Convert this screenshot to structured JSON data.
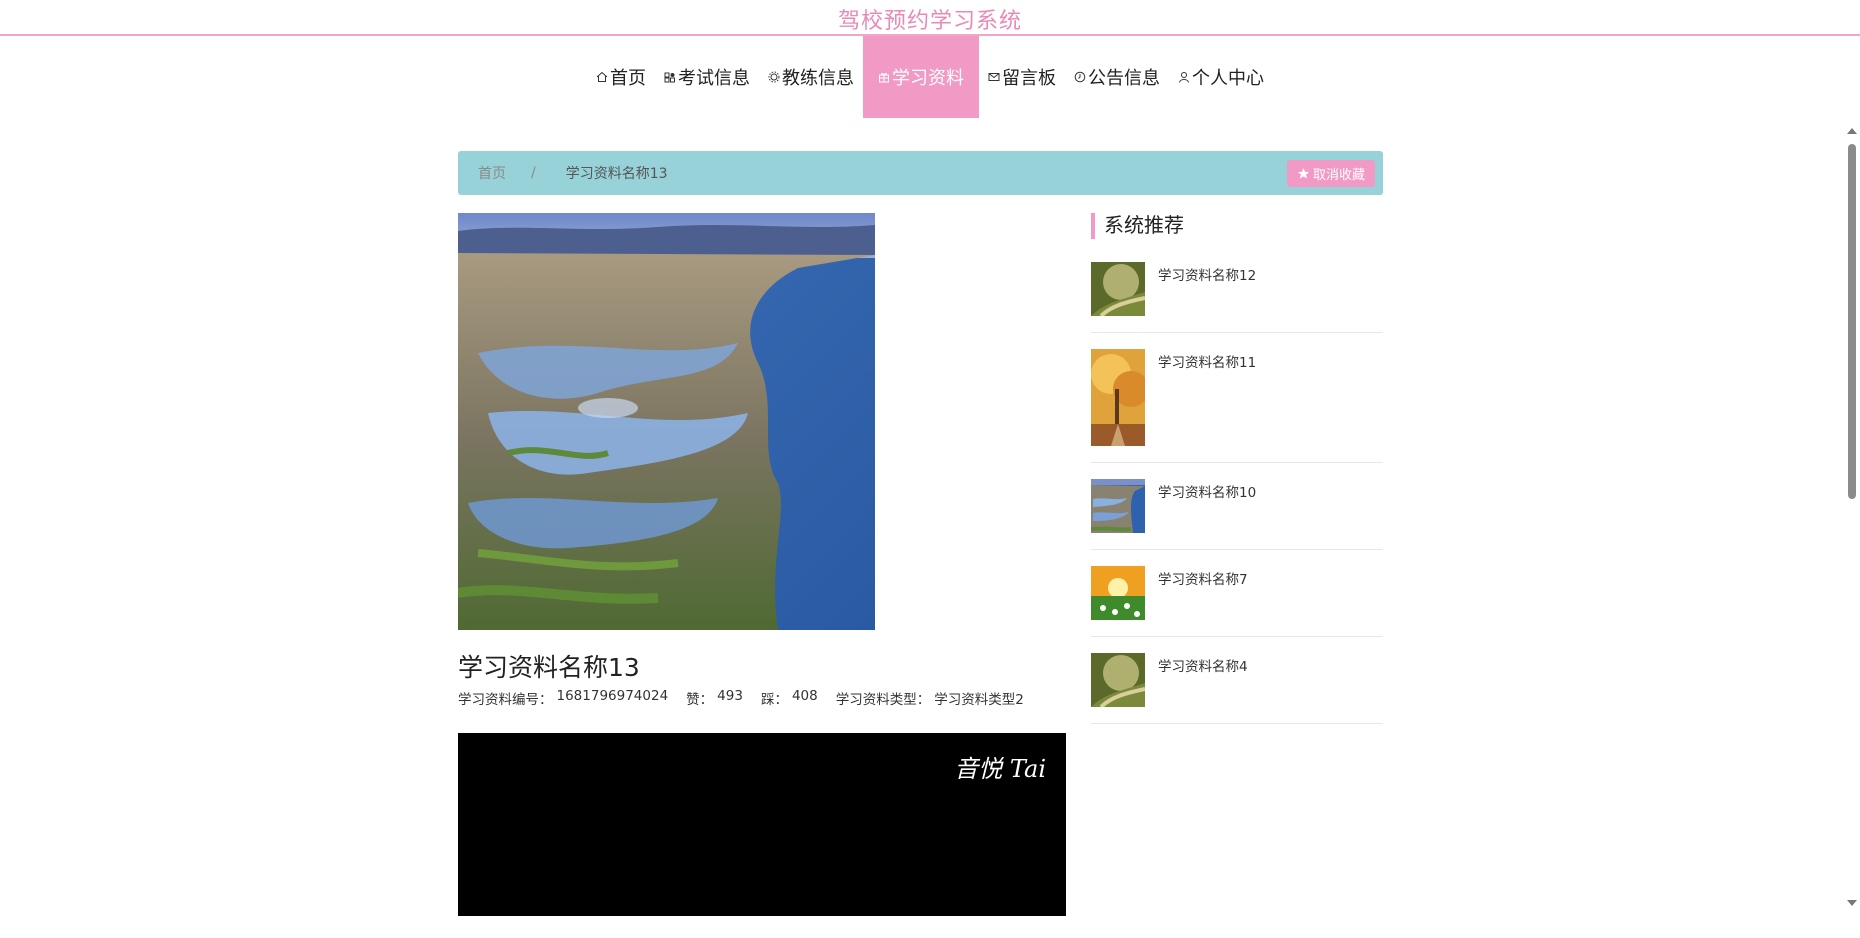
{
  "header": {
    "site_title": "驾校预约学习系统"
  },
  "nav": {
    "items": [
      {
        "label": "首页",
        "icon": "home-icon"
      },
      {
        "label": "考试信息",
        "icon": "grid-icon"
      },
      {
        "label": "教练信息",
        "icon": "settings-icon"
      },
      {
        "label": "学习资料",
        "icon": "gift-icon"
      },
      {
        "label": "留言板",
        "icon": "mail-icon"
      },
      {
        "label": "公告信息",
        "icon": "clock-icon"
      },
      {
        "label": "个人中心",
        "icon": "user-icon"
      }
    ],
    "active": "学习资料"
  },
  "breadcrumb": {
    "home": "首页",
    "separator": "/",
    "current": "学习资料名称13"
  },
  "favorite_button": {
    "label": "取消收藏"
  },
  "detail": {
    "title": "学习资料名称13",
    "code_label": "学习资料编号：",
    "code_value": "1681796974024",
    "like_label": "赞：",
    "like_value": "493",
    "dislike_label": "踩：",
    "dislike_value": "408",
    "type_label": "学习资料类型：",
    "type_value": "学习资料类型2"
  },
  "video": {
    "watermark": "音悦 Tai"
  },
  "recommend": {
    "title": "系统推荐",
    "items": [
      {
        "name": "学习资料名称12"
      },
      {
        "name": "学习资料名称11"
      },
      {
        "name": "学习资料名称10"
      },
      {
        "name": "学习资料名称7"
      },
      {
        "name": "学习资料名称4"
      }
    ]
  },
  "colors": {
    "brand_pink": "#f09ac5",
    "breadcrumb_teal": "#97d2d8"
  }
}
